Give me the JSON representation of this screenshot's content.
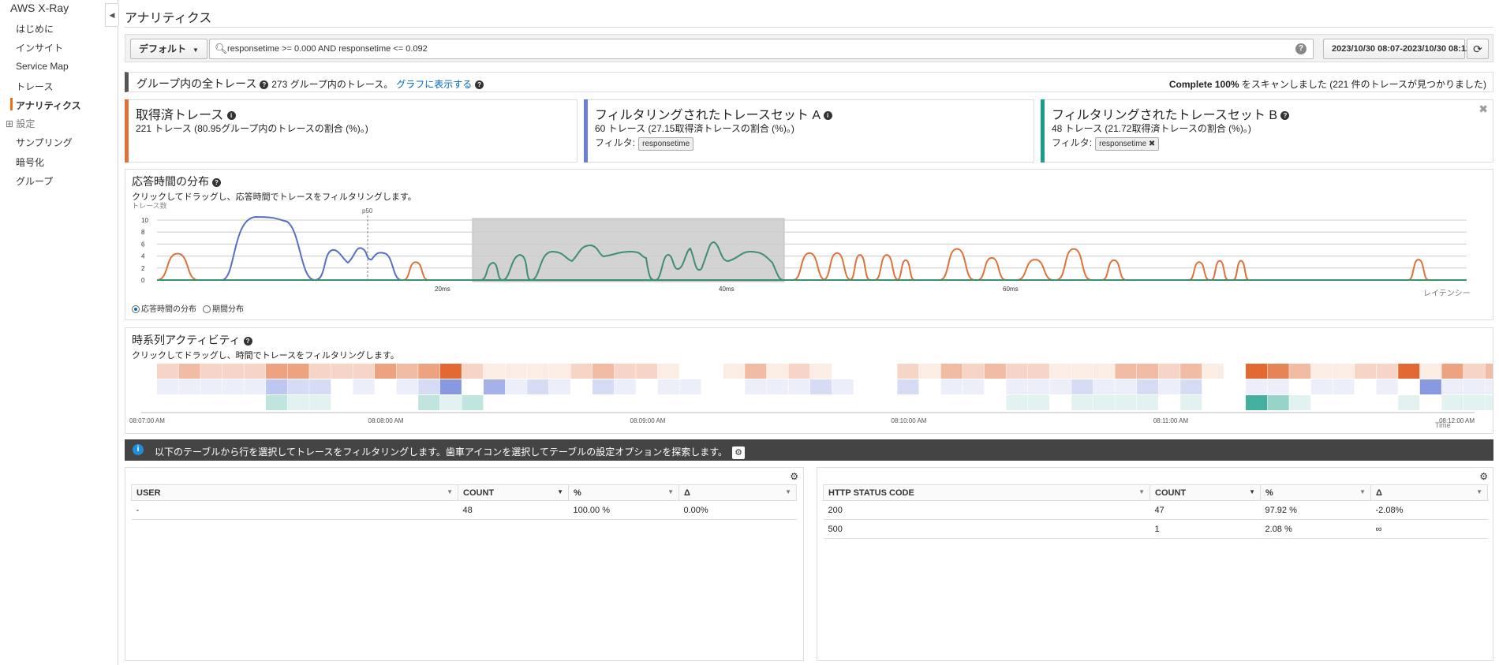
{
  "sidebar": {
    "title": "AWS X-Ray",
    "items": [
      {
        "label": "はじめに"
      },
      {
        "label": "インサイト"
      },
      {
        "label": "Service Map"
      },
      {
        "label": "トレース"
      },
      {
        "label": "アナリティクス"
      }
    ],
    "group_label": "⊞ 設定",
    "settings_items": [
      {
        "label": "サンプリング"
      },
      {
        "label": "暗号化"
      },
      {
        "label": "グループ"
      }
    ]
  },
  "header": {
    "title": "アナリティクス"
  },
  "toolbar": {
    "group_dropdown": "デフォルト",
    "query": "responsetime >= 0.000 AND responsetime <= 0.092",
    "time_range": "2023/10/30 08:07-2023/10/30 08:12"
  },
  "group_bar": {
    "title": "グループ内の全トレース",
    "count_text": "273 グループ内のトレース。",
    "link": "グラフに表示する",
    "scan_bold": "Complete 100%",
    "scan_rest": " をスキャンしました (221 件のトレースが見つかりました)"
  },
  "cards": [
    {
      "title": "取得済トレース",
      "subtitle": "221 トレース (80.95グループ内のトレースの割合 (%)。)",
      "color": "#e2703a"
    },
    {
      "title": "フィルタリングされたトレースセット A",
      "subtitle": "60 トレース (27.15取得済トレースの割合 (%)。)",
      "filter_label": "フィルタ:",
      "chip": "responsetime",
      "color": "#6b80d4"
    },
    {
      "title": "フィルタリングされたトレースセット B",
      "subtitle": "48 トレース (21.72取得済トレースの割合 (%)。)",
      "filter_label": "フィルタ:",
      "chip": "responsetime",
      "chip_close": "✖",
      "close": "✖",
      "color": "#1b9d8a"
    }
  ],
  "response_dist": {
    "title": "応答時間の分布",
    "subtitle": "クリックしてドラッグし、応答時間でトレースをフィルタリングします。",
    "radio_1": "応答時間の分布",
    "radio_2": "期間分布"
  },
  "chart_data": [
    {
      "type": "area",
      "ylabel": "トレース数",
      "xlabel": "レイテンシー",
      "y_ticks": [
        "10",
        "8",
        "6",
        "4",
        "2",
        "0"
      ],
      "ylim": [
        0,
        10
      ],
      "x_ticks": [
        "20ms",
        "40ms",
        "60ms"
      ],
      "annotation": "p50",
      "series": [
        {
          "color": "#e2703a"
        },
        {
          "color": "#5a6fc4"
        },
        {
          "color": "#3d8f6f"
        }
      ]
    },
    {
      "type": "heatmap",
      "x_ticks": [
        "08:07:00 AM",
        "08:08:00 AM",
        "08:09:00 AM",
        "08:10:00 AM",
        "08:11:00 AM",
        "08:12:00 AM"
      ],
      "xlabel": "Time"
    }
  ],
  "timeline": {
    "title": "時系列アクティビティ",
    "subtitle": "クリックしてドラッグし、時間でトレースをフィルタリングします。"
  },
  "info": {
    "text": "以下のテーブルから行を選択してトレースをフィルタリングします。歯車アイコンを選択してテーブルの設定オプションを探索します。"
  },
  "table_left": {
    "headers": [
      "USER",
      "COUNT",
      "%",
      "Δ"
    ],
    "rows": [
      [
        "-",
        "48",
        "100.00 %",
        "0.00%"
      ]
    ]
  },
  "table_right": {
    "headers": [
      "HTTP STATUS CODE",
      "COUNT",
      "%",
      "Δ"
    ],
    "rows": [
      [
        "200",
        "47",
        "97.92 %",
        "-2.08%"
      ],
      [
        "500",
        "1",
        "2.08 %",
        "∞"
      ]
    ]
  }
}
